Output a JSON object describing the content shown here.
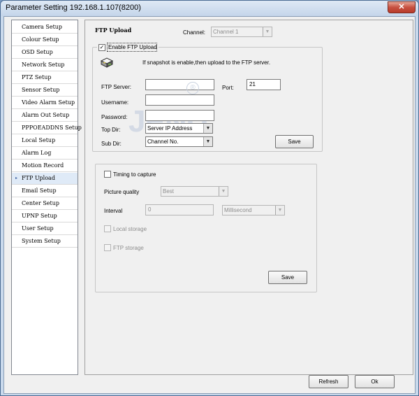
{
  "window": {
    "title": "Parameter Setting 192.168.1.107(8200)",
    "close_glyph": "✕"
  },
  "sidebar": {
    "items": [
      {
        "label": "Camera Setup"
      },
      {
        "label": "Colour Setup"
      },
      {
        "label": "OSD Setup"
      },
      {
        "label": "Network Setup"
      },
      {
        "label": "PTZ Setup"
      },
      {
        "label": "Sensor Setup"
      },
      {
        "label": "Video Alarm Setup"
      },
      {
        "label": "Alarm Out Setup"
      },
      {
        "label": "PPPOEADDNS Setup"
      },
      {
        "label": "Local Setup"
      },
      {
        "label": "Alarm Log"
      },
      {
        "label": "Motion Record"
      },
      {
        "label": "FTP Upload",
        "active": true
      },
      {
        "label": "Email Setup"
      },
      {
        "label": "Center Setup"
      },
      {
        "label": "UPNP Setup"
      },
      {
        "label": "User Setup"
      },
      {
        "label": "System Setup"
      }
    ],
    "active_marker": "▸"
  },
  "panel": {
    "title": "FTP Upload",
    "channel_label": "Channel:",
    "channel_value": "Channel 1"
  },
  "ftp": {
    "enable_label": "Enable FTP Upload",
    "enable_checked": "✓",
    "info": "If snapshot is enable,then upload to the FTP server.",
    "server_label": "FTP Server:",
    "server_value": "",
    "port_label": "Port:",
    "port_value": "21",
    "username_label": "Username:",
    "username_value": "",
    "password_label": "Password:",
    "password_value": "",
    "topdir_label": "Top Dir:",
    "topdir_value": "Server IP Address",
    "subdir_label": "Sub Dir:",
    "subdir_value": "Channel No.",
    "save_label": "Save"
  },
  "timing": {
    "capture_label": "Timing to capture",
    "quality_label": "Picture quality",
    "quality_value": "Best",
    "interval_label": "Interval",
    "interval_value": "0",
    "interval_unit": "Millisecond",
    "local_storage_label": "Local storage",
    "ftp_storage_label": "FTP storage",
    "save_label": "Save"
  },
  "footer": {
    "refresh_label": "Refresh",
    "ok_label": "Ok"
  },
  "icons": {
    "ftp": "ftp-server-icon",
    "dropdown": "▼",
    "registered": "®"
  },
  "watermark": "JENU"
}
